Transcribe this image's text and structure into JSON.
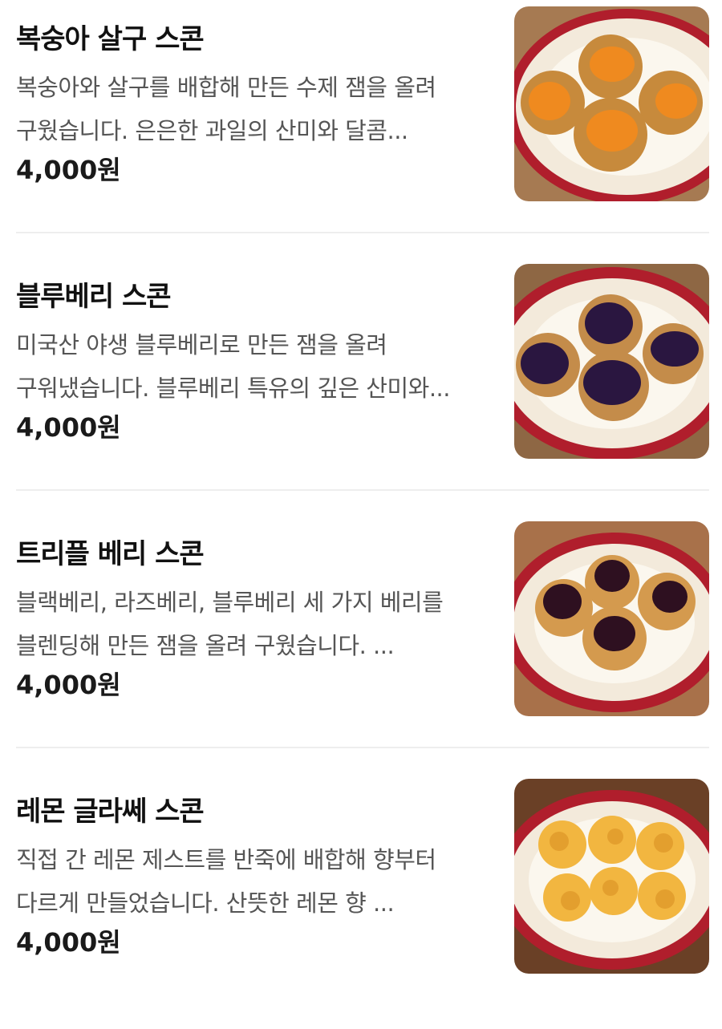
{
  "menu": {
    "items": [
      {
        "name": "복숭아 살구 스콘",
        "description": "복숭아와 살구를 배합해 만든 수제 잼을 올려 구웠습니다. 은은한 과일의 산미와 달콤...",
        "price": "4,000원",
        "photo_icon": "peach-apricot-scone-photo",
        "jam_color": "#ef8a1f"
      },
      {
        "name": "블루베리 스콘",
        "description": "미국산 야생 블루베리로 만든 잼을 올려 구워냈습니다. 블루베리 특유의 깊은 산미와...",
        "price": "4,000원",
        "photo_icon": "blueberry-scone-photo",
        "jam_color": "#2a1640"
      },
      {
        "name": "트리플 베리 스콘",
        "description": "블랙베리, 라즈베리, 블루베리 세 가지 베리를 블렌딩해 만든 잼을 올려 구웠습니다. ...",
        "price": "4,000원",
        "photo_icon": "triple-berry-scone-photo",
        "jam_color": "#2e1020"
      },
      {
        "name": "레몬 글라쎄 스콘",
        "description": "직접 간 레몬 제스트를 반죽에 배합해 향부터 다르게 만들었습니다. 산뜻한 레몬 향 ...",
        "price": "4,000원",
        "photo_icon": "lemon-glace-scone-photo",
        "jam_color": "#f2b640"
      }
    ]
  }
}
